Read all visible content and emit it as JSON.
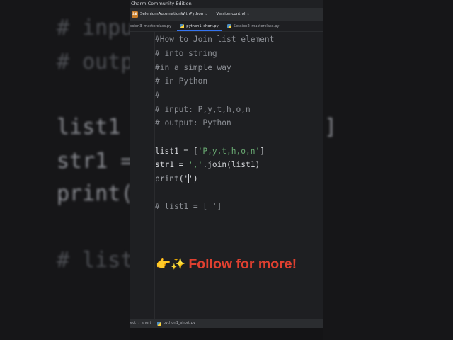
{
  "window": {
    "title": "Charm Community Edition",
    "project_badge": "SA",
    "project_name": "SeleniumAutomationWithPython",
    "vcs_label": "Version control"
  },
  "tabs": [
    {
      "label": "ssion3_masterclass.py",
      "active": false
    },
    {
      "label": "python1_short.py",
      "active": true
    },
    {
      "label": "Session2_masterclass.py",
      "active": false
    }
  ],
  "editor": {
    "lines": [
      "#How to Join list element",
      "# into string",
      "#in a simple way",
      "# in Python",
      "#",
      "# input: P,y,t,h,o,n",
      "# output: Python",
      "",
      "",
      "",
      "",
      "",
      "# list1 = ['']"
    ],
    "list_line": {
      "prefix": "list1 = [",
      "string": "'P,y,t,h,o,n'",
      "suffix": "]"
    },
    "join_line": {
      "prefix": "str1 = ",
      "string": "','",
      "suffix": ".join(list1)"
    },
    "print_line": {
      "func": "print",
      "open": "('",
      "after_caret": "')"
    }
  },
  "breadcrumb": [
    "ect",
    "short",
    "python1_short.py"
  ],
  "background_text": {
    "left": [
      "# inpu",
      "# outp",
      "list1",
      "str1 =",
      "print(",
      "# list"
    ],
    "right": [
      "]"
    ]
  },
  "cta": {
    "icons": "👉✨",
    "text": "Follow for more!"
  },
  "colors": {
    "editor_bg": "#1e1f22",
    "toolbar_bg": "#2b2d30",
    "comment": "#8c8f95",
    "string": "#6aab73",
    "accent": "#3574f0",
    "cta": "#e04030"
  }
}
